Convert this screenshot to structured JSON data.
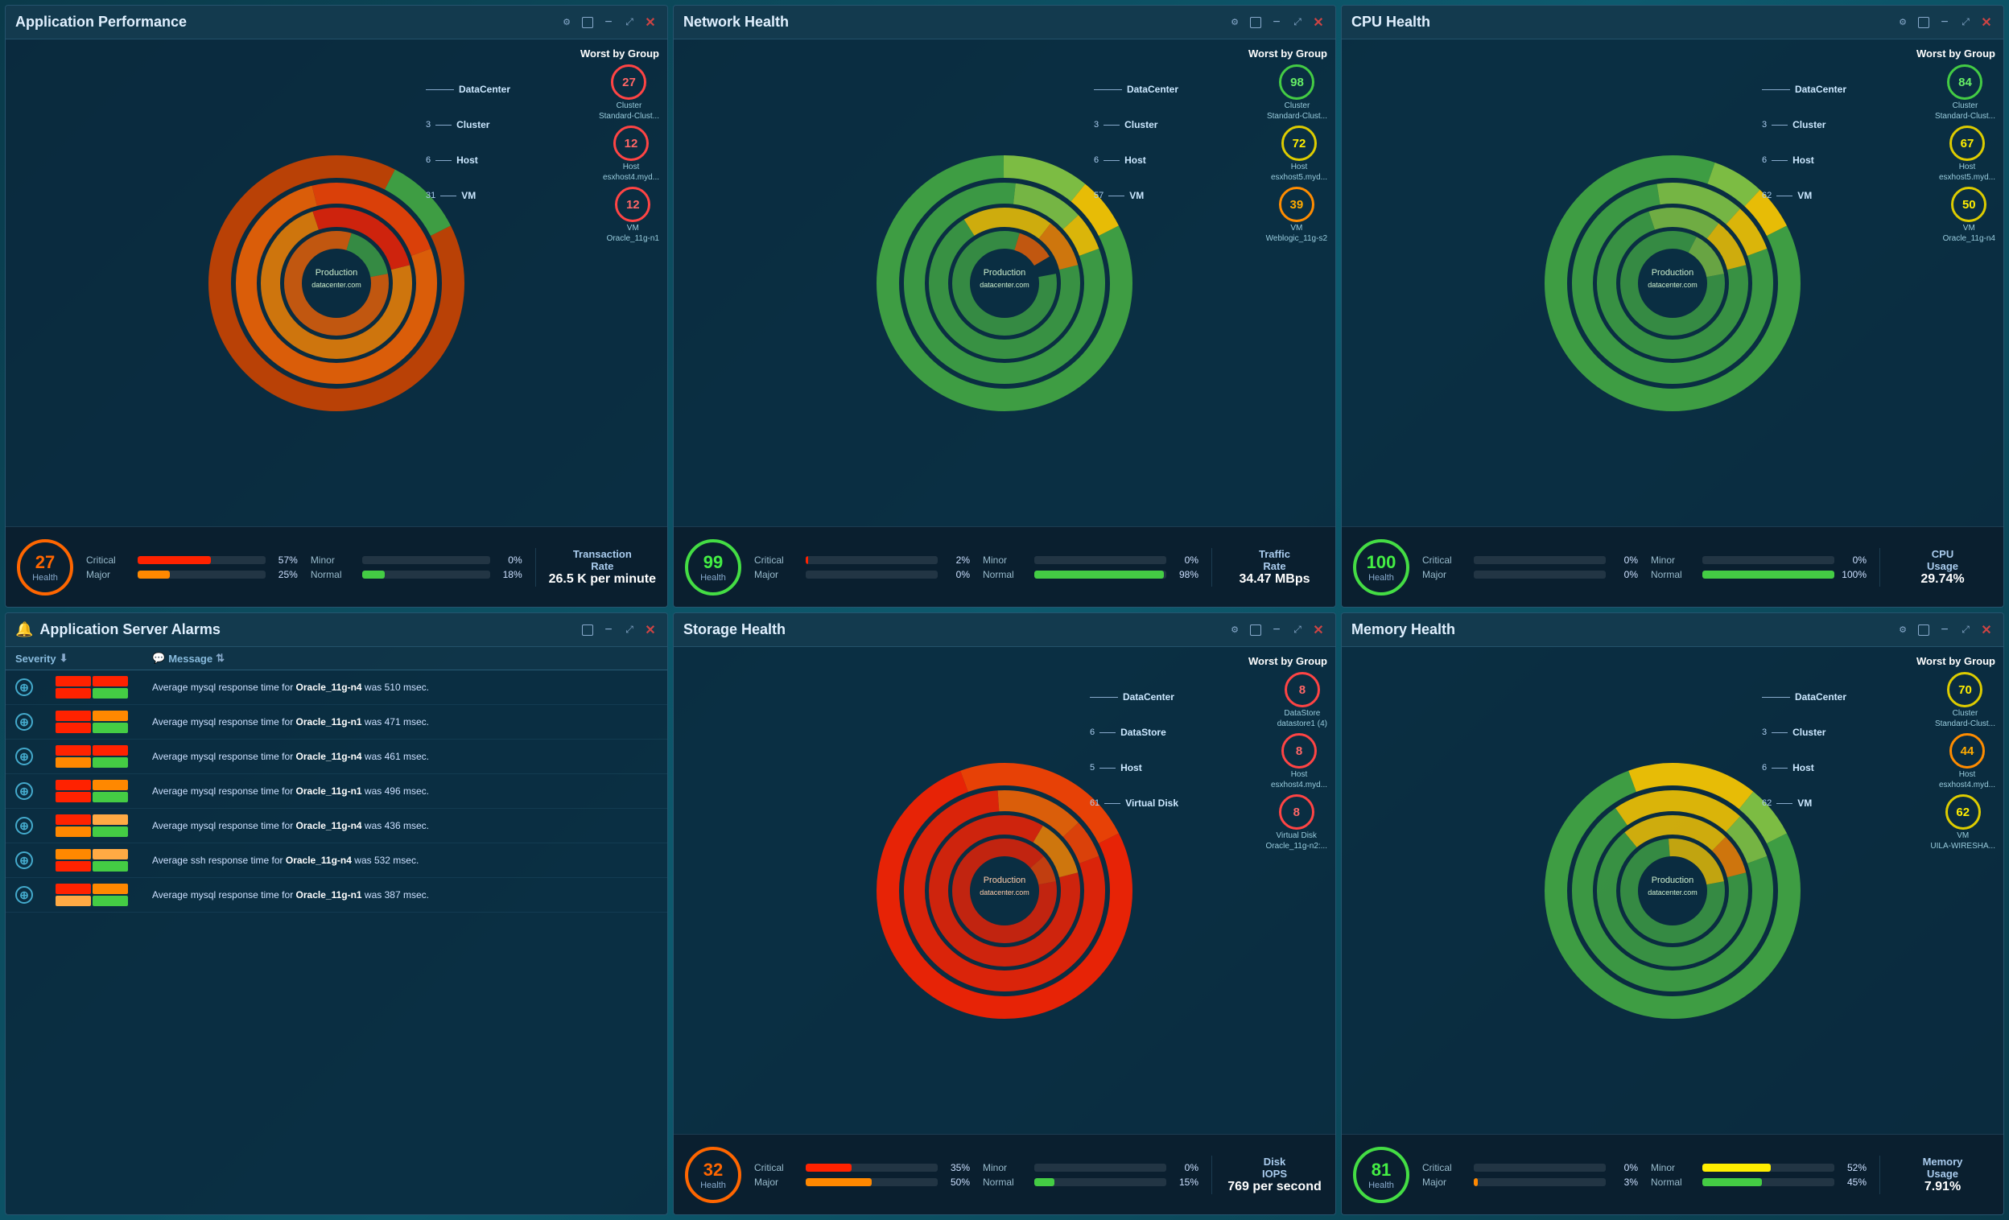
{
  "panels": {
    "app_performance": {
      "title": "Application Performance",
      "health": {
        "value": 27,
        "label": "Health",
        "color": "#ff4400",
        "border": "#ff6600"
      },
      "severity": [
        {
          "name": "Critical",
          "pct": "57%",
          "fill_pct": 57,
          "color": "#ff2200"
        },
        {
          "name": "Minor",
          "pct": "0%",
          "fill_pct": 0,
          "color": "#ffee00"
        },
        {
          "name": "Major",
          "pct": "25%",
          "fill_pct": 25,
          "color": "#ff8800"
        },
        {
          "name": "Normal",
          "pct": "18%",
          "fill_pct": 18,
          "color": "#44cc44"
        }
      ],
      "metric_label": "Transaction\nRate",
      "metric_value": "26.5 K per minute",
      "wbg_title": "Worst by Group",
      "hierarchy": [
        {
          "label": "DataCenter",
          "num": ""
        },
        {
          "label": "Cluster",
          "num": "3"
        },
        {
          "label": "Host",
          "num": "6"
        },
        {
          "label": "VM",
          "num": "31"
        }
      ],
      "wbg_items": [
        {
          "label": "Cluster",
          "sublabel": "Standard-Clust...",
          "value": 27,
          "badge_class": "badge-red"
        },
        {
          "label": "Host",
          "sublabel": "esxhost4.myd...",
          "value": 12,
          "badge_class": "badge-red"
        },
        {
          "label": "VM",
          "sublabel": "Oracle_11g-n1",
          "value": 12,
          "badge_class": "badge-red"
        }
      ]
    },
    "network_health": {
      "title": "Network Health",
      "health": {
        "value": 99,
        "label": "Health",
        "color": "#44cc44",
        "border": "#44dd44"
      },
      "severity": [
        {
          "name": "Critical",
          "pct": "2%",
          "fill_pct": 2,
          "color": "#ff2200"
        },
        {
          "name": "Minor",
          "pct": "0%",
          "fill_pct": 0,
          "color": "#ffee00"
        },
        {
          "name": "Major",
          "pct": "0%",
          "fill_pct": 0,
          "color": "#ff8800"
        },
        {
          "name": "Normal",
          "pct": "98%",
          "fill_pct": 98,
          "color": "#44cc44"
        }
      ],
      "metric_label": "Traffic\nRate",
      "metric_value": "34.47 MBps",
      "wbg_title": "Worst by Group",
      "hierarchy": [
        {
          "label": "DataCenter",
          "num": ""
        },
        {
          "label": "Cluster",
          "num": "3"
        },
        {
          "label": "Host",
          "num": "6"
        },
        {
          "label": "VM",
          "num": "57"
        }
      ],
      "wbg_items": [
        {
          "label": "Cluster",
          "sublabel": "Standard-Clust...",
          "value": 98,
          "badge_class": "badge-green"
        },
        {
          "label": "Host",
          "sublabel": "esxhost5.myd...",
          "value": 72,
          "badge_class": "badge-yellow"
        },
        {
          "label": "VM",
          "sublabel": "Weblogic_11g-s2",
          "value": 39,
          "badge_class": "badge-orange"
        }
      ]
    },
    "cpu_health": {
      "title": "CPU Health",
      "health": {
        "value": 100,
        "label": "Health",
        "color": "#44cc44",
        "border": "#44dd44"
      },
      "severity": [
        {
          "name": "Critical",
          "pct": "0%",
          "fill_pct": 0,
          "color": "#ff2200"
        },
        {
          "name": "Minor",
          "pct": "0%",
          "fill_pct": 0,
          "color": "#ffee00"
        },
        {
          "name": "Major",
          "pct": "0%",
          "fill_pct": 0,
          "color": "#ff8800"
        },
        {
          "name": "Normal",
          "pct": "100%",
          "fill_pct": 100,
          "color": "#44cc44"
        }
      ],
      "metric_label": "CPU\nUsage",
      "metric_value": "29.74%",
      "wbg_title": "Worst by Group",
      "hierarchy": [
        {
          "label": "DataCenter",
          "num": ""
        },
        {
          "label": "Cluster",
          "num": "3"
        },
        {
          "label": "Host",
          "num": "6"
        },
        {
          "label": "VM",
          "num": "62"
        }
      ],
      "wbg_items": [
        {
          "label": "Cluster",
          "sublabel": "Standard-Clust...",
          "value": 84,
          "badge_class": "badge-green"
        },
        {
          "label": "Host",
          "sublabel": "esxhost5.myd...",
          "value": 67,
          "badge_class": "badge-yellow"
        },
        {
          "label": "VM",
          "sublabel": "Oracle_11g-n4",
          "value": 50,
          "badge_class": "badge-yellow"
        }
      ]
    },
    "app_server_alarms": {
      "title": "Application Server Alarms",
      "col_severity": "Severity",
      "col_message": "Message",
      "alarms": [
        {
          "message_prefix": "Average mysql response time for ",
          "entity": "Oracle_11g-n4",
          "message_suffix": " was 510 msec.",
          "sev": [
            "#ff2200",
            "#ff8800",
            "#ffee00",
            "#44cc44"
          ]
        },
        {
          "message_prefix": "Average mysql response time for ",
          "entity": "Oracle_11g-n1",
          "message_suffix": " was 471 msec.",
          "sev": [
            "#ff2200",
            "#ff8800",
            "#ffee00",
            "#44cc44"
          ]
        },
        {
          "message_prefix": "Average mysql response time for ",
          "entity": "Oracle_11g-n4",
          "message_suffix": " was 461 msec.",
          "sev": [
            "#ff2200",
            "#ff8800",
            "#ffee00",
            "#44cc44"
          ]
        },
        {
          "message_prefix": "Average mysql response time for ",
          "entity": "Oracle_11g-n1",
          "message_suffix": " was 496 msec.",
          "sev": [
            "#ff2200",
            "#ff8800",
            "#ffee00",
            "#44cc44"
          ]
        },
        {
          "message_prefix": "Average mysql response time for ",
          "entity": "Oracle_11g-n4",
          "message_suffix": " was 436 msec.",
          "sev": [
            "#ff2200",
            "#ff8800",
            "#ffaa44",
            "#44cc44"
          ]
        },
        {
          "message_prefix": "Average ssh response time for ",
          "entity": "Oracle_11g-n4",
          "message_suffix": " was 532 msec.",
          "sev": [
            "#ff2200",
            "#ff8800",
            "#ffaa44",
            "#44cc44"
          ]
        },
        {
          "message_prefix": "Average mysql response time for ",
          "entity": "Oracle_11g-n1",
          "message_suffix": " was 387 msec.",
          "sev": [
            "#ff2200",
            "#ff8800",
            "#ffaa44",
            "#44cc44"
          ]
        }
      ]
    },
    "storage_health": {
      "title": "Storage Health",
      "health": {
        "value": 32,
        "label": "Health",
        "color": "#ff4400",
        "border": "#ff6600"
      },
      "severity": [
        {
          "name": "Critical",
          "pct": "35%",
          "fill_pct": 35,
          "color": "#ff2200"
        },
        {
          "name": "Minor",
          "pct": "0%",
          "fill_pct": 0,
          "color": "#ffee00"
        },
        {
          "name": "Major",
          "pct": "50%",
          "fill_pct": 50,
          "color": "#ff8800"
        },
        {
          "name": "Normal",
          "pct": "15%",
          "fill_pct": 15,
          "color": "#44cc44"
        }
      ],
      "metric_label": "Disk\nIOPS",
      "metric_value": "769 per second",
      "wbg_title": "Worst by Group",
      "hierarchy": [
        {
          "label": "DataCenter",
          "num": ""
        },
        {
          "label": "DataStore",
          "num": "6"
        },
        {
          "label": "Host",
          "num": "5"
        },
        {
          "label": "Virtual Disk",
          "num": "61"
        }
      ],
      "wbg_items": [
        {
          "label": "DataStore",
          "sublabel": "datastore1 (4)",
          "value": 8,
          "badge_class": "badge-red"
        },
        {
          "label": "Host",
          "sublabel": "esxhost4.myd...",
          "value": 8,
          "badge_class": "badge-red"
        },
        {
          "label": "Virtual Disk",
          "sublabel": "Oracle_11g-n2:...",
          "value": 8,
          "badge_class": "badge-red"
        }
      ]
    },
    "memory_health": {
      "title": "Memory Health",
      "health": {
        "value": 81,
        "label": "Health",
        "color": "#44cc44",
        "border": "#44dd44"
      },
      "severity": [
        {
          "name": "Critical",
          "pct": "0%",
          "fill_pct": 0,
          "color": "#ff2200"
        },
        {
          "name": "Minor",
          "pct": "52%",
          "fill_pct": 52,
          "color": "#ffee00"
        },
        {
          "name": "Major",
          "pct": "3%",
          "fill_pct": 3,
          "color": "#ff8800"
        },
        {
          "name": "Normal",
          "pct": "45%",
          "fill_pct": 45,
          "color": "#44cc44"
        }
      ],
      "metric_label": "Memory\nUsage",
      "metric_value": "7.91%",
      "wbg_title": "Worst by Group",
      "hierarchy": [
        {
          "label": "DataCenter",
          "num": ""
        },
        {
          "label": "Cluster",
          "num": "3"
        },
        {
          "label": "Host",
          "num": "6"
        },
        {
          "label": "VM",
          "num": "62"
        }
      ],
      "wbg_items": [
        {
          "label": "Cluster",
          "sublabel": "Standard-Clust...",
          "value": 70,
          "badge_class": "badge-yellow"
        },
        {
          "label": "Host",
          "sublabel": "esxhost4.myd...",
          "value": 44,
          "badge_class": "badge-orange"
        },
        {
          "label": "VM",
          "sublabel": "UILA-WIRESHA...",
          "value": 62,
          "badge_class": "badge-yellow"
        }
      ]
    }
  }
}
